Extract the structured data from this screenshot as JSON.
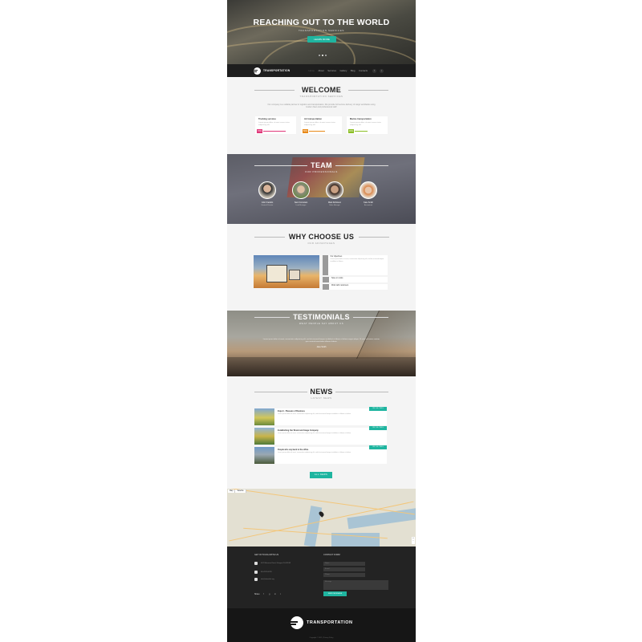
{
  "hero": {
    "title": "REACHING OUT TO THE WORLD",
    "subtitle": "TRANSPORTATION SERVICES",
    "button": "LEARN MORE"
  },
  "nav": {
    "logo": "TRANSPORTATION",
    "items": [
      "Home",
      "About",
      "Services",
      "Gallery",
      "Blog",
      "Contacts"
    ]
  },
  "welcome": {
    "title": "WELCOME",
    "subtitle": "TRANSPORTATION SERVICES",
    "text": "Our company is a reliable partner in logistics and transportation. We provide full service delivery of cargo worldwide using modern fleet and professional staff.",
    "cards": [
      {
        "title": "Trucking services",
        "text": "Lorem ipsum dolor sit amet conse ctetur adipisicing elit.",
        "pct": "70%",
        "color": "#e0397a"
      },
      {
        "title": "Air transportation",
        "text": "Lorem ipsum dolor sit amet conse ctetur adipisicing elit.",
        "pct": "50%",
        "color": "#e88a1a"
      },
      {
        "title": "Marine transportation",
        "text": "Lorem ipsum dolor sit amet conse ctetur adipisicing elit.",
        "pct": "40%",
        "color": "#8cbf26"
      }
    ]
  },
  "team": {
    "title": "TEAM",
    "subtitle": "OUR PROFESSIONALS",
    "members": [
      {
        "name": "John Franklin",
        "role": "General Director"
      },
      {
        "name": "Sam Kromstain",
        "role": "Lead Manager"
      },
      {
        "name": "Mark Robinson",
        "role": "Sales Manager"
      },
      {
        "name": "Kate Smith",
        "role": "Accountant"
      }
    ]
  },
  "why": {
    "title": "WHY CHOOSE US",
    "subtitle": "OUR ADVANTAGES",
    "items": [
      {
        "label": "Our objectives",
        "desc": "Lorem ipsum dolor sit amet, consectetur adipisicing elit, sed do eiusmod tempor incididunt ut labore."
      },
      {
        "label": "Save on costs",
        "desc": ""
      },
      {
        "label": "Work with customers",
        "desc": ""
      }
    ]
  },
  "testimonials": {
    "title": "TESTIMONIALS",
    "subtitle": "WHAT PEOPLE SAY ABOUT US",
    "text": "Lorem ipsum dolor sit amet, consectetur adipisicing elit, sed do eiusmod tempor incididunt ut labore et dolore magna aliqua. Ut enim ad minim veniam, quis nostrud exercitation ullamco laboris.",
    "author": "Jane Smith"
  },
  "news": {
    "title": "NEWS",
    "subtitle": "LATEST NEWS",
    "items": [
      {
        "title": "Export - Pleasure of Business",
        "text": "Lorem ipsum dolor sit amet, consectetur adipisicing elit, sed do eiusmod tempor incididunt ut labore et dolore.",
        "date": "28 / 10 / 2015"
      },
      {
        "title": "Establishing Our Brand and Image Company",
        "text": "Lorem ipsum dolor sit amet, consectetur adipisicing elit, sed do eiusmod tempor incididunt ut labore et dolore.",
        "date": "28 / 10 / 2015"
      },
      {
        "title": "People who say back to the office",
        "text": "Lorem ipsum dolor sit amet, consectetur adipisicing elit, sed do eiusmod tempor incididunt ut labore et dolore.",
        "date": "28 / 10 / 2015"
      }
    ],
    "button": "ALL NEWS"
  },
  "map": {
    "controls": [
      "Map",
      "Satellite"
    ]
  },
  "footer": {
    "get_in_touch": "GET IN TOUCH WITH US",
    "address": "4578 Marmora Road, Glasgow D04 89GR",
    "phone": "800-2345-6789",
    "email": "info@demolink.org",
    "share": "Share:",
    "contact_form": "CONTACT FORM",
    "name_placeholder": "Name",
    "email_placeholder": "E-mail",
    "phone_placeholder": "Phone",
    "message_placeholder": "Message",
    "submit": "SEND MESSAGE",
    "logo": "TRANSPORTATION",
    "copyright": "Copyright © 2015 | Privacy Policy"
  }
}
